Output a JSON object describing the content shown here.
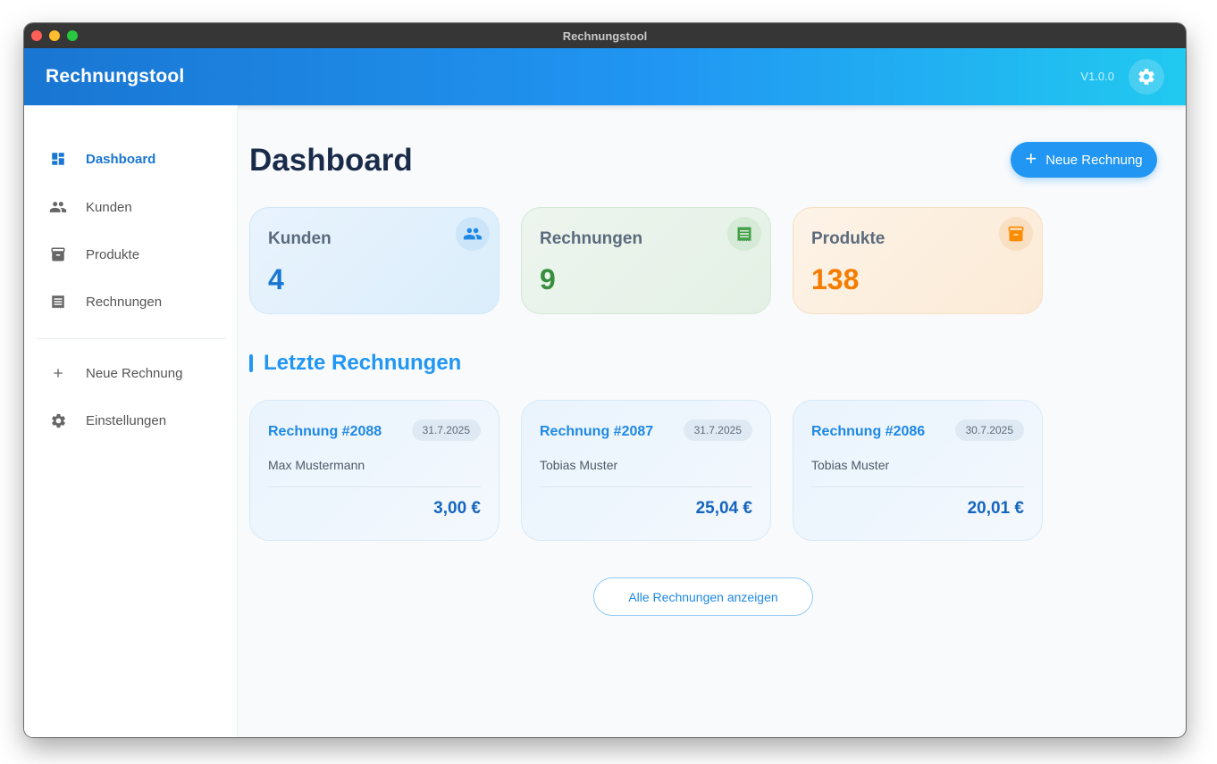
{
  "window": {
    "title": "Rechnungstool"
  },
  "appbar": {
    "title": "Rechnungstool",
    "version": "V1.0.0",
    "settings_icon": "gear-icon"
  },
  "sidebar": {
    "items": [
      {
        "label": "Dashboard",
        "icon": "dashboard-icon",
        "active": true
      },
      {
        "label": "Kunden",
        "icon": "people-icon"
      },
      {
        "label": "Produkte",
        "icon": "archive-icon"
      },
      {
        "label": "Rechnungen",
        "icon": "receipt-icon"
      },
      {
        "label": "Neue Rechnung",
        "icon": "plus-icon"
      },
      {
        "label": "Einstellungen",
        "icon": "gear-icon"
      }
    ]
  },
  "main": {
    "title": "Dashboard",
    "new_invoice_label": "Neue Rechnung",
    "stats": [
      {
        "label": "Kunden",
        "value": "4",
        "icon": "people-icon",
        "color": "#1976d2"
      },
      {
        "label": "Rechnungen",
        "value": "9",
        "icon": "receipt-icon",
        "color": "#388e3c"
      },
      {
        "label": "Produkte",
        "value": "138",
        "icon": "archive-icon",
        "color": "#f57c00"
      }
    ],
    "recent_title": "Letzte Rechnungen",
    "invoices": [
      {
        "title": "Rechnung #2088",
        "date": "31.7.2025",
        "customer": "Max Mustermann",
        "amount": "3,00 €"
      },
      {
        "title": "Rechnung #2087",
        "date": "31.7.2025",
        "customer": "Tobias Muster",
        "amount": "25,04 €"
      },
      {
        "title": "Rechnung #2086",
        "date": "30.7.2025",
        "customer": "Tobias Muster",
        "amount": "20,01 €"
      }
    ],
    "show_all_label": "Alle Rechnungen anzeigen"
  },
  "colors": {
    "primary": "#2196f3",
    "primary_dark": "#1976d2",
    "green": "#388e3c",
    "orange": "#f57c00"
  }
}
